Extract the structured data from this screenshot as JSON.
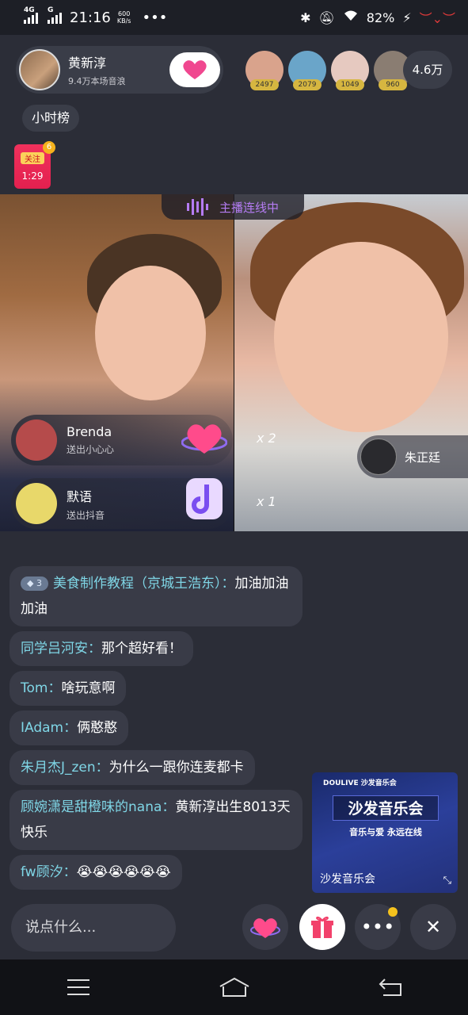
{
  "status_bar": {
    "network_1": "4G",
    "network_2": "G",
    "time": "21:16",
    "speed_value": "600",
    "speed_unit": "KB/s",
    "more": "•••",
    "battery": "82%"
  },
  "anchor": {
    "name": "黄新淳",
    "fans": "9.4万本场音浪"
  },
  "viewers": [
    {
      "score": "2497",
      "color": "#d9a38c"
    },
    {
      "score": "2079",
      "color": "#6aa5c9"
    },
    {
      "score": "1049",
      "color": "#e6c9c0"
    },
    {
      "score": "960",
      "color": "#8a7d72"
    }
  ],
  "viewer_count": "4.6万",
  "sub_tag": "小时榜",
  "red_packet": {
    "label": "关注",
    "time": "1:29",
    "badge": "6"
  },
  "link_status": "主播连线中",
  "gift_messages": [
    {
      "name": "Brenda",
      "action": "送出小心心",
      "combo": "x 2",
      "avatar_color": "#b54b4b"
    },
    {
      "name": "默语",
      "action": "送出抖音",
      "combo": "x 1",
      "avatar_color": "#e8d86a"
    }
  ],
  "guest": {
    "name": "朱正廷"
  },
  "chat": [
    {
      "level": "3",
      "user": "美食制作教程（京城王浩东）：",
      "text": "加油加油加油"
    },
    {
      "level": "",
      "user": "同学吕河安：",
      "text": "那个超好看！"
    },
    {
      "level": "",
      "user": "Tom：",
      "text": "啥玩意啊"
    },
    {
      "level": "",
      "user": "IAdam：",
      "text": "俩憨憨"
    },
    {
      "level": "",
      "user": "朱月杰J_zen：",
      "text": "为什么一跟你连麦都卡"
    },
    {
      "level": "",
      "user": "顾婉潇是甜橙味的nana：",
      "text": "黄新淳出生8013天快乐"
    },
    {
      "level": "",
      "user": "fw顾汐：",
      "text": "😭😭😭😭😭😭"
    }
  ],
  "ad": {
    "brand": "DOULIVE 沙发音乐会",
    "title": "沙发音乐会",
    "slogan": "音乐与爱 永远在线",
    "caption": "沙发音乐会"
  },
  "input_placeholder": "说点什么..."
}
